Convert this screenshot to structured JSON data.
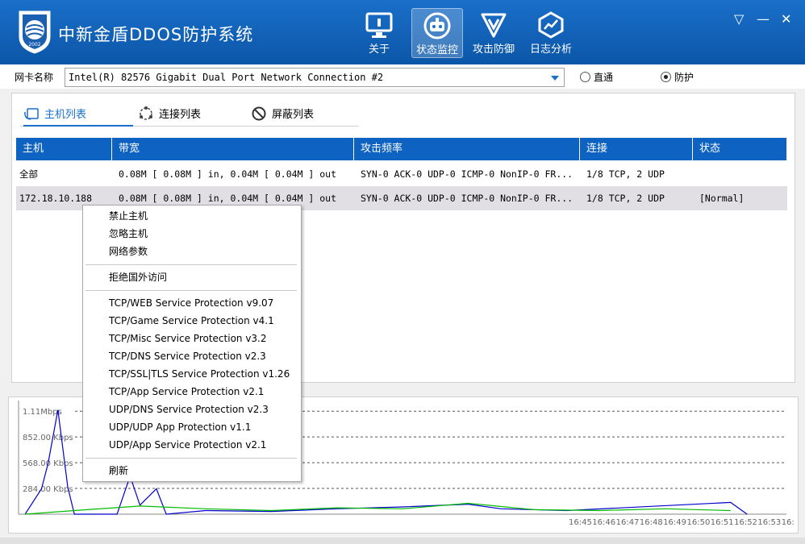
{
  "app": {
    "title": "中新金盾DDOS防护系统",
    "logo_year": "2002"
  },
  "nav": [
    {
      "label": "关于",
      "icon": "monitor-icon",
      "active": false
    },
    {
      "label": "状态监控",
      "icon": "robot-icon",
      "active": true
    },
    {
      "label": "攻击防御",
      "icon": "shield-icon",
      "active": false
    },
    {
      "label": "日志分析",
      "icon": "chart-icon",
      "active": false
    }
  ],
  "window_controls": {
    "dropdown": "▽",
    "minimize": "—",
    "close": "✕"
  },
  "nic": {
    "label": "网卡名称",
    "value": "Intel(R) 82576 Gigabit Dual Port Network Connection #2",
    "mode_options": [
      "直通",
      "防护"
    ],
    "mode_selected": "防护"
  },
  "tabs": [
    {
      "label": "主机列表",
      "active": true
    },
    {
      "label": "连接列表",
      "active": false
    },
    {
      "label": "屏蔽列表",
      "active": false
    }
  ],
  "table": {
    "columns": [
      "主机",
      "带宽",
      "攻击频率",
      "连接",
      "状态"
    ],
    "rows": [
      [
        "全部",
        "0.08M [ 0.08M ] in, 0.04M [ 0.04M ] out",
        "SYN-0 ACK-0 UDP-0 ICMP-0 NonIP-0 FR...",
        "1/8 TCP, 2 UDP",
        ""
      ],
      [
        "172.18.10.188",
        "0.08M [ 0.08M ] in, 0.04M [ 0.04M ] out",
        "SYN-0 ACK-0 UDP-0 ICMP-0 NonIP-0 FR...",
        "1/8 TCP, 2 UDP",
        "[Normal]"
      ]
    ]
  },
  "context_menu": {
    "group1": [
      "禁止主机",
      "忽略主机",
      "网络参数"
    ],
    "group2": [
      "拒绝国外访问"
    ],
    "group3": [
      "TCP/WEB Service Protection v9.07",
      "TCP/Game Service Protection v4.1",
      "TCP/Misc Service Protection v3.2",
      "TCP/DNS Service Protection v2.3",
      "TCP/SSL|TLS Service Protection v1.26",
      "TCP/App Service Protection v2.1",
      "UDP/DNS Service Protection v2.3",
      "UDP/UDP App Protection v1.1",
      "UDP/App Service Protection v2.1"
    ],
    "group4": [
      "刷新"
    ]
  },
  "chart_data": {
    "type": "line",
    "ytick_labels": [
      "1.11Mbps",
      "852.00 Kbps",
      "568.00 Kbps",
      "284.00 Kbps"
    ],
    "yticks_kbps": [
      1136,
      852,
      568,
      284
    ],
    "ylim_kbps": [
      0,
      1200
    ],
    "x_tick_labels": [
      "16:45",
      "16:46",
      "16:47",
      "16:48",
      "16:49",
      "16:50",
      "16:51",
      "16:52",
      "16:53",
      "16:"
    ],
    "grid": true,
    "series": [
      {
        "color": "#0000cc",
        "points": [
          [
            16.735,
            0
          ],
          [
            16.74,
            280
          ],
          [
            16.742,
            560
          ],
          [
            16.745,
            1150
          ],
          [
            16.748,
            300
          ],
          [
            16.75,
            0
          ],
          [
            16.763,
            0
          ],
          [
            16.767,
            420
          ],
          [
            16.77,
            100
          ],
          [
            16.775,
            280
          ],
          [
            16.778,
            0
          ],
          [
            16.79,
            40
          ],
          [
            16.81,
            30
          ],
          [
            16.83,
            60
          ],
          [
            16.85,
            80
          ],
          [
            16.87,
            110
          ],
          [
            16.88,
            60
          ],
          [
            16.9,
            40
          ],
          [
            16.95,
            130
          ],
          [
            16.955,
            0
          ]
        ]
      },
      {
        "color": "#00bb00",
        "points": [
          [
            16.735,
            0
          ],
          [
            16.75,
            40
          ],
          [
            16.77,
            90
          ],
          [
            16.79,
            60
          ],
          [
            16.81,
            40
          ],
          [
            16.83,
            70
          ],
          [
            16.85,
            60
          ],
          [
            16.87,
            120
          ],
          [
            16.89,
            50
          ],
          [
            16.91,
            40
          ],
          [
            16.93,
            60
          ],
          [
            16.95,
            40
          ]
        ]
      }
    ],
    "colors": {
      "in": "#0000cc",
      "out": "#00bb00"
    }
  }
}
